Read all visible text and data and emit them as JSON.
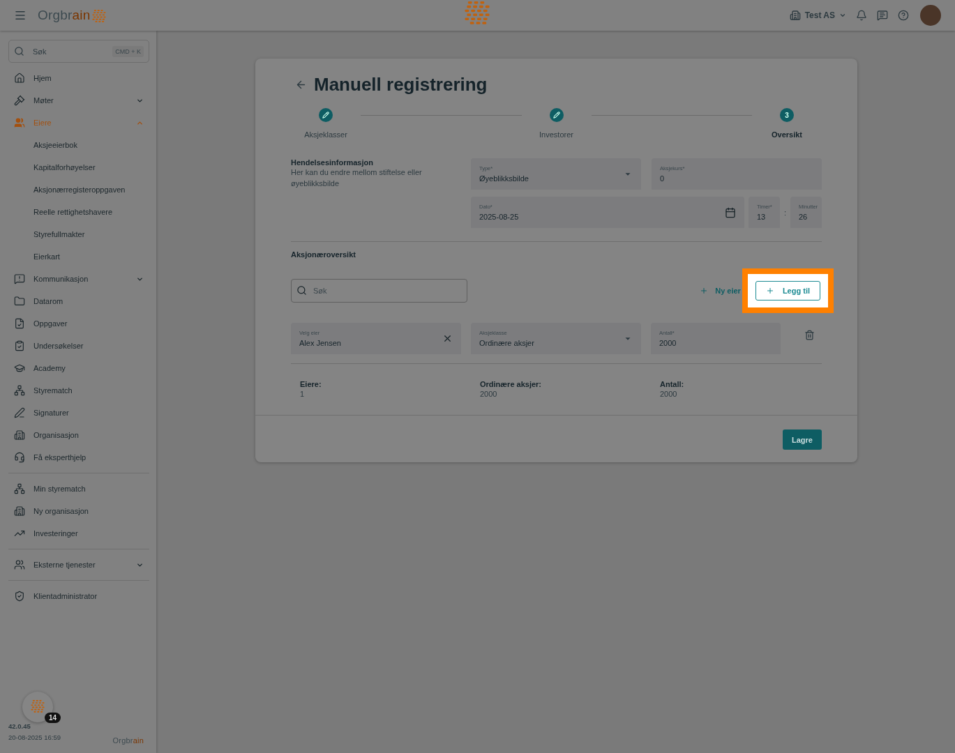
{
  "topbar": {
    "logo": [
      {
        "text": "Orgbr",
        "accent": false
      },
      {
        "text": "ain",
        "accent": true
      }
    ],
    "organization": "Test AS"
  },
  "sidebar": {
    "search": {
      "placeholder": "Søk",
      "shortcut": "CMD + K"
    },
    "groups": [
      {
        "items": [
          {
            "label": "Hjem",
            "selected": false
          },
          {
            "label": "Møter",
            "expandable": true,
            "expanded": false,
            "selected": false
          },
          {
            "label": "Eiere",
            "expandable": true,
            "expanded": true,
            "selected": true,
            "children": [
              {
                "label": "Aksjeeierbok"
              },
              {
                "label": "Kapitalforhøyelser"
              },
              {
                "label": "Aksjonærregisteroppgaven"
              },
              {
                "label": "Reelle rettighetshavere"
              },
              {
                "label": "Styrefullmakter"
              },
              {
                "label": "Eierkart"
              }
            ]
          },
          {
            "label": "Kommunikasjon",
            "expandable": true,
            "expanded": false,
            "selected": false
          },
          {
            "label": "Datarom",
            "selected": false
          },
          {
            "label": "Oppgaver",
            "selected": false
          },
          {
            "label": "Undersøkelser",
            "selected": false
          },
          {
            "label": "Academy",
            "selected": false
          },
          {
            "label": "Styrematch",
            "selected": false
          },
          {
            "label": "Signaturer",
            "selected": false
          },
          {
            "label": "Organisasjon",
            "selected": false
          },
          {
            "label": "Få eksperthjelp",
            "selected": false
          }
        ]
      },
      {
        "items": [
          {
            "label": "Min styrematch",
            "selected": false
          },
          {
            "label": "Ny organisasjon",
            "selected": false
          },
          {
            "label": "Investeringer",
            "selected": false
          }
        ]
      },
      {
        "items": [
          {
            "label": "Eksterne tjenester",
            "expandable": true,
            "expanded": false,
            "selected": false
          }
        ]
      },
      {
        "items": [
          {
            "label": "Klientadministrator",
            "selected": false
          }
        ]
      }
    ],
    "footer": {
      "badge": "14",
      "version": "42.0.45",
      "build_date": "20-08-2025 16:59",
      "logo": [
        {
          "text": "Orgbr",
          "accent": false
        },
        {
          "text": "ain",
          "accent": true
        }
      ]
    }
  },
  "page": {
    "title": "Manuell registrering",
    "steps": [
      {
        "label": "Aksjeklasser",
        "completed": true,
        "selected": false
      },
      {
        "label": "Investorer",
        "completed": true,
        "selected": false
      },
      {
        "label": "Oversikt",
        "completed": false,
        "number": "3",
        "selected": true
      }
    ],
    "event_info": {
      "heading": "Hendelsesinformasjon",
      "description": "Her kan du endre mellom stiftelse eller øyeblikksbilde",
      "type": {
        "label": "Type*",
        "value": "Øyeblikksbilde"
      },
      "share_price": {
        "label": "Aksjekurs*",
        "value": "0"
      },
      "date": {
        "label": "Dato*",
        "value": "2025-08-25"
      },
      "hours": {
        "label": "Timer*",
        "value": "13"
      },
      "separator": ":",
      "minutes": {
        "label": "Minutter",
        "value": "26"
      }
    },
    "shareholders": {
      "heading": "Aksjonæroversikt",
      "search": {
        "placeholder": "Søk"
      },
      "new_owner": "Ny eier",
      "add_button": {
        "label": "Legg til",
        "highlighted": true
      },
      "rows": [
        {
          "owner": {
            "label": "Velg eier",
            "value": "Alex Jensen"
          },
          "share_class": {
            "label": "Aksjeklasse",
            "value": "Ordinære aksjer"
          },
          "count": {
            "label": "Antall*",
            "value": "2000"
          }
        }
      ],
      "summary": [
        {
          "label": "Eiere:",
          "value": "1"
        },
        {
          "label": "Ordinære aksjer:",
          "value": "2000"
        },
        {
          "label": "Antall:",
          "value": "2000"
        }
      ]
    },
    "save_button": "Lagre"
  }
}
